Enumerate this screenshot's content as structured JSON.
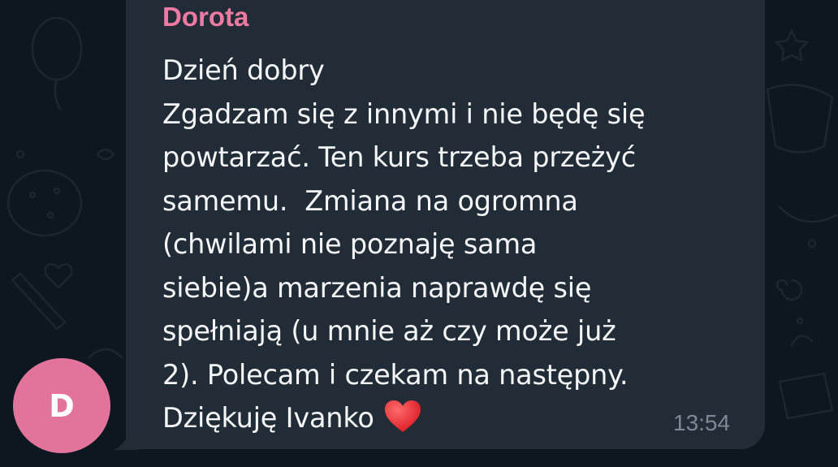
{
  "chat": {
    "sender_name": "Dorota",
    "avatar_initial": "D",
    "message_lines": [
      "Dzień dobry",
      "Zgadzam się z innymi i nie będę się",
      "powtarzać. Ten kurs trzeba przeżyć",
      "samemu.  Zmiana na ogromna",
      "(chwilami nie poznaję sama",
      "siebie)a marzenia naprawdę się",
      "spełniają (u mnie aż czy może już",
      "2). Polecam i czekam na następny.",
      "Dziękuję Ivanko "
    ],
    "emoji": "heart-emoji",
    "timestamp": "13:54"
  },
  "colors": {
    "background": "#0d1720",
    "bubble": "#222c36",
    "sender_name": "#ee7aa4",
    "avatar": "#e2749b",
    "message_text": "#f4f6f8",
    "timestamp": "#7c8895",
    "heart": "#e8262f"
  }
}
